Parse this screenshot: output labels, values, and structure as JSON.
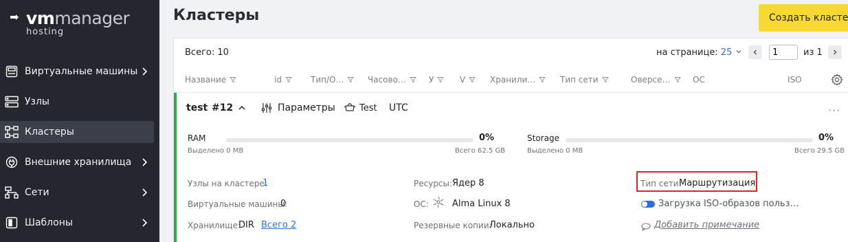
{
  "logo": {
    "vm": "vm",
    "manager": "manager",
    "sub": "hosting"
  },
  "sidebar": {
    "items": [
      {
        "label": "Виртуальные машины",
        "icon": "vm-icon",
        "chevron": true
      },
      {
        "label": "Узлы",
        "icon": "nodes-icon",
        "chevron": false
      },
      {
        "label": "Кластеры",
        "icon": "clusters-icon",
        "chevron": false,
        "active": true
      },
      {
        "label": "Внешние хранилища",
        "icon": "plug-icon",
        "chevron": true
      },
      {
        "label": "Сети",
        "icon": "network-icon",
        "chevron": true
      },
      {
        "label": "Шаблоны",
        "icon": "template-icon",
        "chevron": true
      }
    ]
  },
  "header": {
    "title": "Кластеры",
    "create_button": "Создать кластер"
  },
  "list": {
    "total": "Всего: 10",
    "per_page_label": "на странице:",
    "per_page_value": "25",
    "page": "1",
    "of": "из 1"
  },
  "columns": [
    "Название",
    "id",
    "Тип/О…",
    "Часово…",
    "У",
    "V",
    "Хранили…",
    "Тип сети",
    "Оверсе…",
    "ОС",
    "ISO"
  ],
  "cluster": {
    "name": "test",
    "id": "#12",
    "params_label": "Параметры",
    "test_label": "Test",
    "timezone": "UTC",
    "ram": {
      "label": "RAM",
      "pct": "0%",
      "used": "Выделено 0 MB",
      "total": "Всего 62.5 GB",
      "fill": 0
    },
    "storage": {
      "label": "Storage",
      "pct": "0%",
      "used": "Выделено 0 MB",
      "total": "Всего 29.5 GB",
      "fill": 0
    },
    "nodes_label": "Узлы на кластере:",
    "nodes_value": "1",
    "vms_label": "Виртуальные машины:",
    "vms_value": "0",
    "storage_label": "Хранилище:",
    "storage_value": "DIR",
    "storage_link": "Всего 2",
    "resources_label": "Ресурсы:",
    "resources_value": "Ядер 8",
    "os_label": "ОС:",
    "os_value": "Alma Linux 8",
    "backup_label": "Резервные копии:",
    "backup_value": "Локально",
    "net_label": "Тип сети:",
    "net_value": "Маршрутизация",
    "iso_toggle_label": "Загрузка ISO-образов польз…",
    "note_link": "Добавить примечание"
  },
  "colors": {
    "accent": "#f8d832",
    "sidebar": "#24272e",
    "link": "#2f6fd9",
    "status": "#34a853",
    "highlight": "#d82424"
  }
}
